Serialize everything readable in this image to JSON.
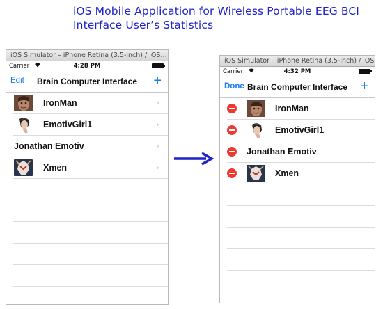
{
  "page": {
    "title_line1": "iOS Mobile Application for Wireless Portable EEG BCI",
    "title_line2": "Interface User’s Statistics"
  },
  "left_screen": {
    "window_title": "iOS Simulator – iPhone Retina (3.5-inch) / iOS…",
    "carrier": "Carrier",
    "time": "4:28 PM",
    "nav_left": "Edit",
    "nav_title": "Brain Computer Interface",
    "nav_add": "+",
    "rows": [
      {
        "name": "IronMan",
        "icon": "ironman-avatar-icon"
      },
      {
        "name": "EmotivGirl1",
        "icon": "emotiv-headset-avatar-icon"
      },
      {
        "name": "Jonathan Emotiv",
        "icon": ""
      },
      {
        "name": "Xmen",
        "icon": "xmen-avatar-icon"
      }
    ]
  },
  "right_screen": {
    "window_title": "iOS Simulator – iPhone Retina (3.5-inch) / iOS…",
    "carrier": "Carrier",
    "time": "4:32 PM",
    "nav_left": "Done",
    "nav_title": "Brain Computer Interface",
    "nav_add": "+",
    "rows": [
      {
        "name": "IronMan",
        "icon": "ironman-avatar-icon"
      },
      {
        "name": "EmotivGirl1",
        "icon": "emotiv-headset-avatar-icon"
      },
      {
        "name": "Jonathan Emotiv",
        "icon": ""
      },
      {
        "name": "Xmen",
        "icon": "xmen-avatar-icon"
      }
    ]
  },
  "colors": {
    "title_text": "#1e22c8",
    "ios_tint": "#1a7cf5",
    "delete_red": "#ed3b32",
    "arrow": "#1e22c8"
  },
  "icons": {
    "arrow": "right-arrow-icon",
    "wifi": "wifi-icon",
    "battery": "battery-icon",
    "chevron": "chevron-right-icon",
    "delete": "delete-minus-icon"
  }
}
